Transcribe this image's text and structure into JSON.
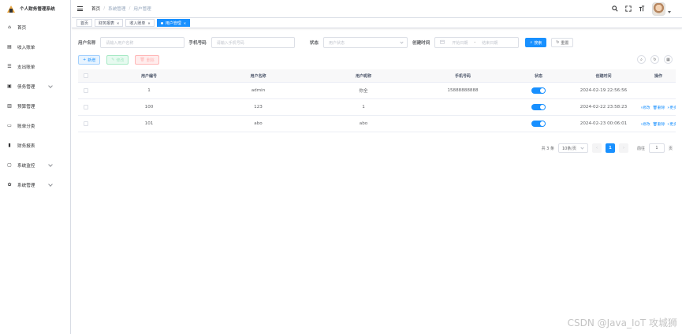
{
  "app": {
    "title": "个人财务管理系统"
  },
  "sidebar": {
    "items": [
      {
        "label": "首页",
        "icon": "home-icon",
        "arrow": false
      },
      {
        "label": "收入账单",
        "icon": "document-icon",
        "arrow": false
      },
      {
        "label": "支出账单",
        "icon": "list-icon",
        "arrow": false
      },
      {
        "label": "债务管理",
        "icon": "wallet-icon",
        "arrow": true
      },
      {
        "label": "预算管理",
        "icon": "book-icon",
        "arrow": false
      },
      {
        "label": "账单分类",
        "icon": "folder-icon",
        "arrow": false
      },
      {
        "label": "财务报表",
        "icon": "bar-chart-icon",
        "arrow": false
      },
      {
        "label": "系统监控",
        "icon": "monitor-icon",
        "arrow": true
      },
      {
        "label": "系统管理",
        "icon": "gear-icon",
        "arrow": true
      }
    ]
  },
  "header": {
    "breadcrumb": [
      "首页",
      "系统管理",
      "用户管理"
    ]
  },
  "tags": [
    {
      "label": "首页",
      "active": false,
      "closable": false
    },
    {
      "label": "财务报表",
      "active": false,
      "closable": true
    },
    {
      "label": "收入账单",
      "active": false,
      "closable": true
    },
    {
      "label": "用户管理",
      "active": true,
      "closable": true
    }
  ],
  "search": {
    "username_label": "用户名称",
    "username_placeholder": "请输入用户名称",
    "phone_label": "手机号码",
    "phone_placeholder": "请输入手机号码",
    "status_label": "状态",
    "status_placeholder": "用户状态",
    "created_label": "创建时间",
    "start_placeholder": "开始日期",
    "range_sep": "-",
    "end_placeholder": "结束日期",
    "search_btn": "搜索",
    "reset_btn": "重置"
  },
  "toolbar": {
    "add": "新增",
    "edit": "修改",
    "delete": "删除"
  },
  "table": {
    "headers": [
      "用户编号",
      "用户名称",
      "用户昵称",
      "手机号码",
      "状态",
      "创建时间",
      "操作"
    ],
    "rows": [
      {
        "id": "1",
        "name": "admin",
        "nick": "你全",
        "phone": "15888888888",
        "enabled": true,
        "time": "2024-02-19 22:56:56",
        "ops": []
      },
      {
        "id": "100",
        "name": "123",
        "nick": "1",
        "phone": "",
        "enabled": true,
        "time": "2024-02-22 23:58:23",
        "ops": [
          "修改",
          "删除",
          "更多"
        ]
      },
      {
        "id": "101",
        "name": "abo",
        "nick": "abo",
        "phone": "",
        "enabled": true,
        "time": "2024-02-23 00:06:01",
        "ops": [
          "修改",
          "删除",
          "更多"
        ]
      }
    ]
  },
  "pagination": {
    "total": "共 3 条",
    "page_size": "10条/页",
    "current": "1",
    "goto_label": "前往",
    "goto_value": "1",
    "page_unit": "页"
  },
  "watermark": "CSDN @Java_IoT 攻城狮",
  "colors": {
    "primary": "#1890ff",
    "logo": "#e6a23c"
  }
}
